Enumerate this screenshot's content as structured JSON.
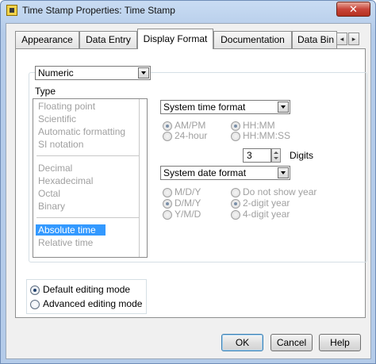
{
  "window": {
    "title": "Time Stamp Properties: Time Stamp",
    "close_label": "✕"
  },
  "tabs": [
    {
      "label": "Appearance"
    },
    {
      "label": "Data Entry"
    },
    {
      "label": "Display Format",
      "active": true
    },
    {
      "label": "Documentation"
    },
    {
      "label": "Data Bin"
    }
  ],
  "tab_scroll": {
    "left": "◂",
    "right": "▸"
  },
  "format_type": {
    "value": "Numeric"
  },
  "type_section": {
    "label": "Type",
    "items": [
      {
        "label": "Floating point"
      },
      {
        "label": "Scientific"
      },
      {
        "label": "Automatic formatting"
      },
      {
        "label": "SI notation"
      },
      {
        "label": "Decimal"
      },
      {
        "label": "Hexadecimal"
      },
      {
        "label": "Octal"
      },
      {
        "label": "Binary"
      },
      {
        "label": "Absolute time",
        "selected": true
      },
      {
        "label": "Relative time"
      }
    ]
  },
  "time_format": {
    "combo_value": "System time format",
    "ampm": "AM/PM",
    "hour24": "24-hour",
    "hhmm": "HH:MM",
    "hhmmss": "HH:MM:SS",
    "digits_value": "3",
    "digits_label": "Digits"
  },
  "date_format": {
    "combo_value": "System date format",
    "mdy": "M/D/Y",
    "dmy": "D/M/Y",
    "ymd": "Y/M/D",
    "no_year": "Do not show year",
    "two_digit": "2-digit year",
    "four_digit": "4-digit year"
  },
  "editing_mode": {
    "default": "Default editing mode",
    "advanced": "Advanced editing mode"
  },
  "buttons": {
    "ok": "OK",
    "cancel": "Cancel",
    "help": "Help"
  },
  "colors": {
    "selection": "#3399ff",
    "title_bar": "#b4cbe9",
    "close_button": "#c8453a"
  }
}
